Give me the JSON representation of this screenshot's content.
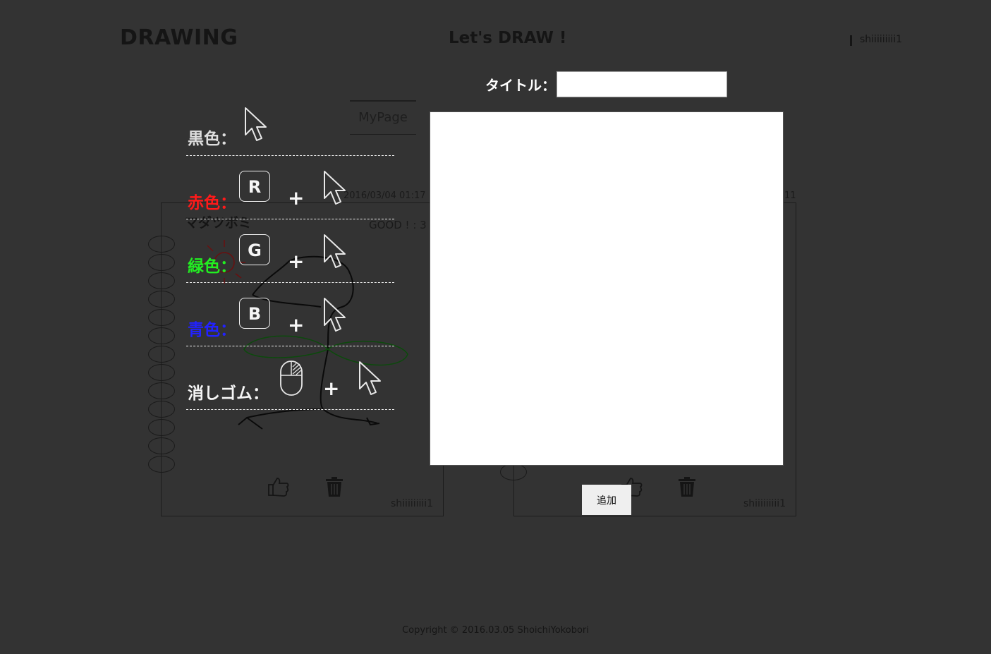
{
  "header": {
    "brand": "DRAWING",
    "title": "Let's DRAW !",
    "user": "shiiiiiiiii1"
  },
  "nav": {
    "tabs": [
      {
        "label": "MyPage"
      }
    ]
  },
  "cards": [
    {
      "date": "2016/03/04 01:17",
      "title": "マダツボミ",
      "good": "GOOD ! : 3",
      "user": "shiiiiiiiii1"
    },
    {
      "date": "11",
      "user": "shiiiiiiiii1"
    }
  ],
  "legend": {
    "black": {
      "label": "黒色：",
      "color": "#dddddd"
    },
    "red": {
      "label": "赤色：",
      "key": "R",
      "color": "#ff1a1a"
    },
    "green": {
      "label": "緑色：",
      "key": "G",
      "color": "#22ee22"
    },
    "blue": {
      "label": "青色：",
      "key": "B",
      "color": "#2222ff"
    },
    "eraser": {
      "label": "消しゴム：",
      "color": "#f5f5f5"
    },
    "plus": "+"
  },
  "modal": {
    "title_label": "タイトル：",
    "title_value": "",
    "add_button": "追加"
  },
  "footer": {
    "copyright": "Copyright © 2016.03.05 ShoichiYokobori"
  }
}
